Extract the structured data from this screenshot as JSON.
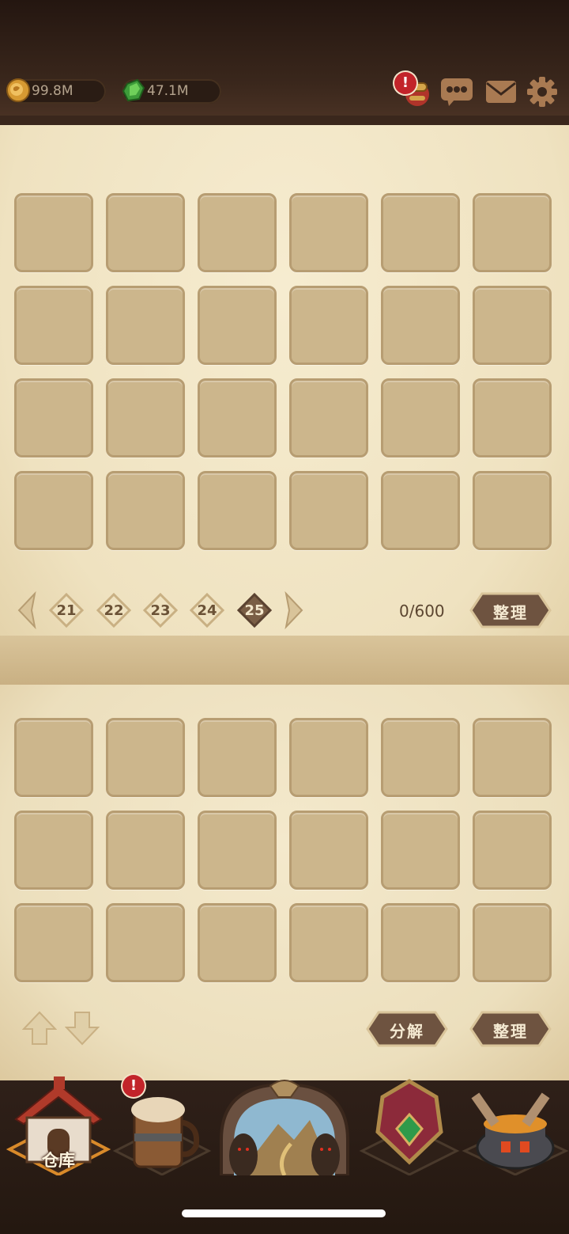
{
  "currency": {
    "gold": "99.8M",
    "gems": "47.1M"
  },
  "icons": [
    "currency-gold-icon",
    "gem-icon",
    "gift-icon",
    "chat-icon",
    "mail-icon",
    "settings-icon"
  ],
  "badge": "!",
  "inventory": {
    "pages": [
      "21",
      "22",
      "23",
      "24",
      "25"
    ],
    "active_page": "25",
    "count": "0/600",
    "sort_label": "整理"
  },
  "lower": {
    "decompose_label": "分解",
    "sort_label": "整理"
  },
  "nav": {
    "warehouse_label": "仓库"
  },
  "colors": {
    "parchment": "#efe2c0",
    "slot": "#ccb68c",
    "button": "#6e5340",
    "frame": "#2a1c14"
  }
}
